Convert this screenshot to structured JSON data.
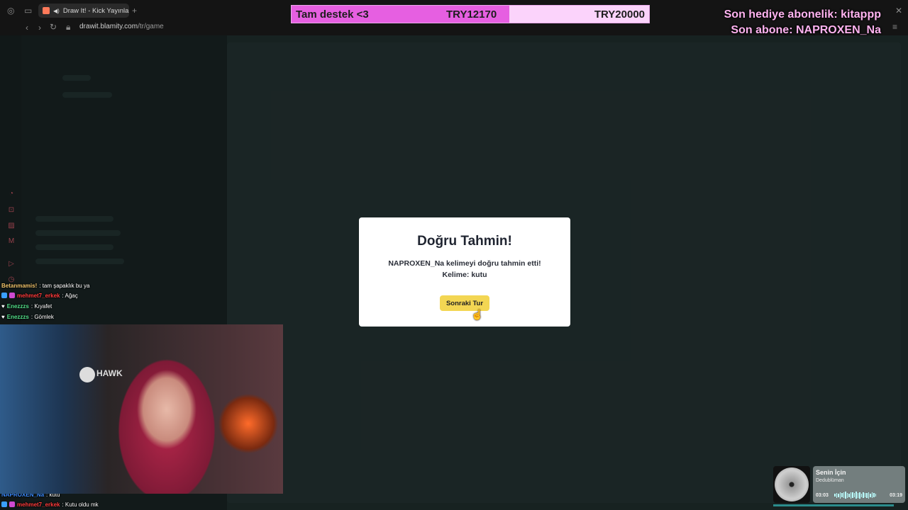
{
  "browser": {
    "tab_title": "Draw It! - Kick Yayınları",
    "url_host": "drawit.blamity.com",
    "url_path": "/tr/game"
  },
  "goal": {
    "label": "Tam destek <3",
    "current": "TRY12170",
    "target": "TRY20000",
    "progress_fraction": 0.6085,
    "fill_color": "#e65fe1"
  },
  "subscribers": {
    "gift_line": "Son hediye abonelik: kitappp",
    "sub_line": "Son abone: NAPROXEN_Na"
  },
  "modal": {
    "title": "Doğru Tahmin!",
    "message": "NAPROXEN_Na kelimeyi doğru tahmin etti! Kelime: kutu",
    "button_label": "Sonraki Tur"
  },
  "chat": [
    {
      "user": "Betanmamis!",
      "text": ": tam şapaklık bu ya",
      "color": "#f0c36b"
    },
    {
      "user": "mehmet7_erkek",
      "text": ": Ağaç",
      "color": "#ff3b3b"
    },
    {
      "user": "Enezzzs",
      "text": ": Kıyafet",
      "color": "#53e08a"
    },
    {
      "user": "Enezzzs",
      "text": ": Gömlek",
      "color": "#53e08a"
    },
    {
      "user": "NAPROXEN_Na",
      "text": ": kutu",
      "color": "#3b8bff"
    },
    {
      "user": "mehmet7_erkek",
      "text": ": Kutu oldu mk",
      "color": "#ff3b3b"
    }
  ],
  "webcam": {
    "chair_brand": "HAWK"
  },
  "music": {
    "title": "Senin İçin",
    "artist": "Dedublüman",
    "elapsed": "03:03",
    "duration": "03:19"
  }
}
